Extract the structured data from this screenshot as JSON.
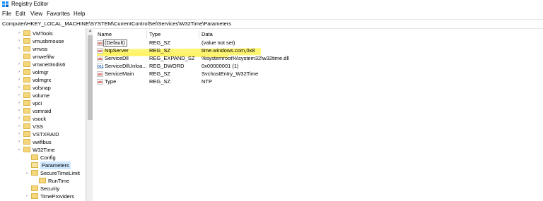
{
  "window": {
    "title": "Registry Editor",
    "icon": "registry-editor-icon"
  },
  "menu": [
    "File",
    "Edit",
    "View",
    "Favorites",
    "Help"
  ],
  "address": "Computer\\HKEY_LOCAL_MACHINE\\SYSTEM\\CurrentControlSet\\Services\\W32Time\\Parameters",
  "tree": [
    {
      "label": "VMTools",
      "level": 0,
      "expander": "collapsed"
    },
    {
      "label": "vmusbmouse",
      "level": 0,
      "expander": "collapsed"
    },
    {
      "label": "vmvss",
      "level": 0,
      "expander": "collapsed"
    },
    {
      "label": "vmwefifw",
      "level": 0,
      "expander": "none"
    },
    {
      "label": "vmxnet3ndis6",
      "level": 0,
      "expander": "collapsed"
    },
    {
      "label": "volmgr",
      "level": 0,
      "expander": "collapsed"
    },
    {
      "label": "volmgrx",
      "level": 0,
      "expander": "collapsed"
    },
    {
      "label": "volsnap",
      "level": 0,
      "expander": "collapsed"
    },
    {
      "label": "volume",
      "level": 0,
      "expander": "collapsed"
    },
    {
      "label": "vpci",
      "level": 0,
      "expander": "collapsed"
    },
    {
      "label": "vsmraid",
      "level": 0,
      "expander": "collapsed"
    },
    {
      "label": "vsock",
      "level": 0,
      "expander": "collapsed"
    },
    {
      "label": "VSS",
      "level": 0,
      "expander": "collapsed"
    },
    {
      "label": "VSTXRAID",
      "level": 0,
      "expander": "collapsed"
    },
    {
      "label": "vwifibus",
      "level": 0,
      "expander": "collapsed"
    },
    {
      "label": "W32Time",
      "level": 0,
      "expander": "expanded"
    },
    {
      "label": "Config",
      "level": 1,
      "expander": "none"
    },
    {
      "label": "Parameters",
      "level": 1,
      "expander": "none",
      "selected": true
    },
    {
      "label": "SecureTimeLimit",
      "level": 1,
      "expander": "expanded"
    },
    {
      "label": "RunTime",
      "level": 2,
      "expander": "none"
    },
    {
      "label": "Security",
      "level": 1,
      "expander": "none"
    },
    {
      "label": "TimeProviders",
      "level": 1,
      "expander": "collapsed"
    }
  ],
  "columns": {
    "name": "Name",
    "type": "Type",
    "data": "Data"
  },
  "values": [
    {
      "name": "(Default)",
      "type": "REG_SZ",
      "data": "(value not set)",
      "icon": "ab"
    },
    {
      "name": "NtpServer",
      "type": "REG_SZ",
      "data": "time.windows.com,0x8",
      "icon": "ab",
      "highlighted": true
    },
    {
      "name": "ServiceDll",
      "type": "REG_EXPAND_SZ",
      "data": "%systemroot%\\system32\\w32time.dll",
      "icon": "ab"
    },
    {
      "name": "ServiceDllUnloa...",
      "type": "REG_DWORD",
      "data": "0x00000001 (1)",
      "icon": "bin"
    },
    {
      "name": "ServiceMain",
      "type": "REG_SZ",
      "data": "SvchostEntry_W32Time",
      "icon": "ab"
    },
    {
      "name": "Type",
      "type": "REG_SZ",
      "data": "NTP",
      "icon": "ab"
    }
  ],
  "colors": {
    "highlight": "#fff35c",
    "selection": "#cde8ff",
    "folder": "#f6d67a",
    "string_icon": "#c0392b",
    "binary_icon": "#2c6fbf"
  }
}
